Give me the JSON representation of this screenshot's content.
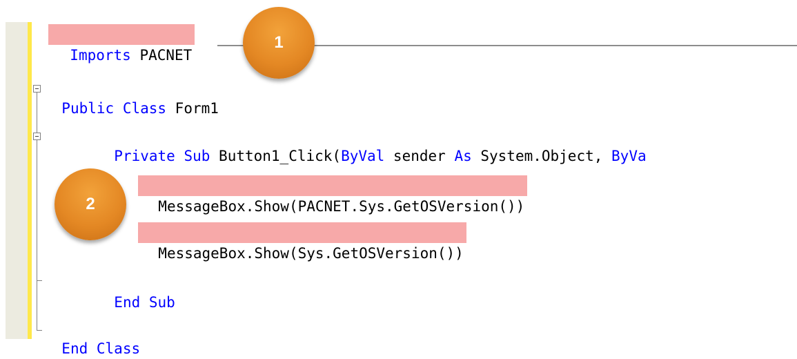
{
  "editor": {
    "lines": {
      "imports": {
        "keyword": "Imports",
        "rest": " PACNET"
      },
      "class_decl": {
        "kw1": "Public",
        "kw2": "Class",
        "name": " Form1"
      },
      "sub_decl": {
        "kw1": "Private",
        "kw2": "Sub",
        "t1": " Button1_Click(",
        "kw3": "ByVal",
        "t2": " sender ",
        "kw4": "As",
        "t3": " System.Object, ",
        "kw5": "ByVa"
      },
      "call1": "MessageBox.Show(PACNET.Sys.GetOSVersion())",
      "call2": "MessageBox.Show(Sys.GetOSVersion())",
      "end_sub": {
        "kw1": "End",
        "kw2": "Sub"
      },
      "end_class": {
        "kw1": "End",
        "kw2": "Class"
      }
    }
  },
  "callouts": {
    "one": "1",
    "two": "2"
  },
  "colors": {
    "keyword": "#0000ff",
    "highlight": "#f7a9a9",
    "callout": "#e48824",
    "gutter": "#ecebe0",
    "change_bar": "#ffe84a"
  }
}
